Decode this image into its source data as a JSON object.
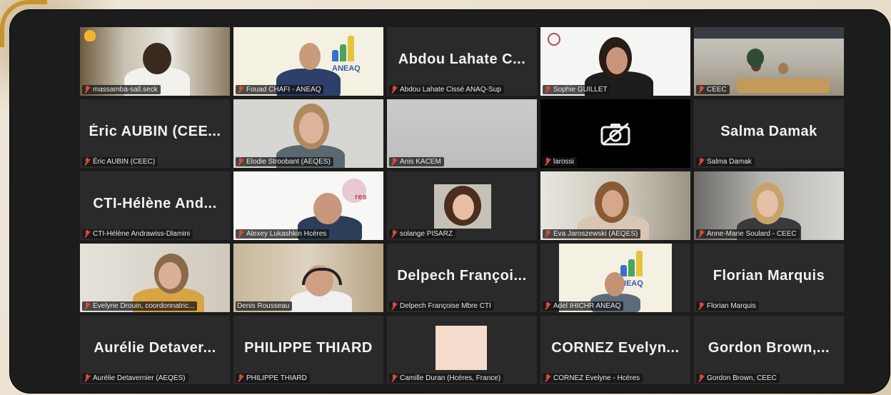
{
  "participants": [
    {
      "name": "massamba-sall.seck",
      "label": "massamba-sall.seck",
      "video": true
    },
    {
      "name": "Fouad CHAFI - ANEAQ",
      "label": "Fouad CHAFI - ANEAQ",
      "video": true,
      "logo": "ANEAQ"
    },
    {
      "name": "Abdou Lahate C...",
      "label": "Abdou Lahate Cissé ANAQ-Sup",
      "video": false
    },
    {
      "name": "Sophie GUILLET",
      "label": "Sophie GUILLET",
      "video": true,
      "active": true
    },
    {
      "name": "CEEC",
      "label": "CEEC",
      "video": true
    },
    {
      "name": "Éric AUBIN (CEE...",
      "label": "Éric AUBIN (CEEC)",
      "video": false
    },
    {
      "name": "Elodie Stroobant (AEQES)",
      "label": "Elodie Stroobant (AEQES)",
      "video": true
    },
    {
      "name": "Anis KACEM",
      "label": "Anis KACEM",
      "video": true
    },
    {
      "name": "larossi",
      "label": "larossi",
      "video": false,
      "camera_off": true
    },
    {
      "name": "Salma Damak",
      "label": "Salma Damak",
      "video": false
    },
    {
      "name": "CTI-Hélène And...",
      "label": "CTI-Hélène Andrawiss-Dlamini",
      "video": false
    },
    {
      "name": "Alexey Lukashkin Hcéres",
      "label": "Alexey Lukashkin Hcéres",
      "video": true,
      "logo": "res"
    },
    {
      "name": "solange PISARZ",
      "label": "solange PISARZ",
      "video": true
    },
    {
      "name": "Eva Jaroszewski (AEQES)",
      "label": "Eva Jaroszewski (AEQES)",
      "video": true
    },
    {
      "name": "Anne-Marie Soulard - CEEC",
      "label": "Anne-Marie Soulard - CEEC",
      "video": true
    },
    {
      "name": "Evelyne Drouin, coordonnatric...",
      "label": "Evelyne Drouin, coordonnatric...",
      "video": true
    },
    {
      "name": "Denis Rousseau",
      "label": "Denis Rousseau",
      "video": true
    },
    {
      "name": "Delpech Françoi...",
      "label": "Delpech Françoise Mbre CTI",
      "video": false
    },
    {
      "name": "Adel IHICHR ANEAQ",
      "label": "Adel IHICHR ANEAQ",
      "video": true,
      "logo": "NEAQ"
    },
    {
      "name": "Florian Marquis",
      "label": "Florian Marquis",
      "video": false
    },
    {
      "name": "Aurélie Detaver...",
      "label": "Aurélie Detavernier (AEQES)",
      "video": false
    },
    {
      "name": "PHILIPPE THIARD",
      "label": "PHILIPPE THIARD",
      "video": false
    },
    {
      "name": "Camille Duran (Hcéres, France)",
      "label": "Camille Duran (Hcéres, France)",
      "video": true
    },
    {
      "name": "CORNEZ Evelyn...",
      "label": "CORNEZ Evelyne - Hcéres",
      "video": false
    },
    {
      "name": "Gordon Brown,...",
      "label": "Gordon Brown, CEEC",
      "video": false
    }
  ],
  "icons": {
    "muted": "mic-muted-icon",
    "camera_off": "camera-off-icon",
    "raised_hand": "raised-hand-icon"
  },
  "colors": {
    "active_speaker": "#9fd35d",
    "muted": "#d84a3c",
    "tile_bg": "#2a2a2a"
  }
}
